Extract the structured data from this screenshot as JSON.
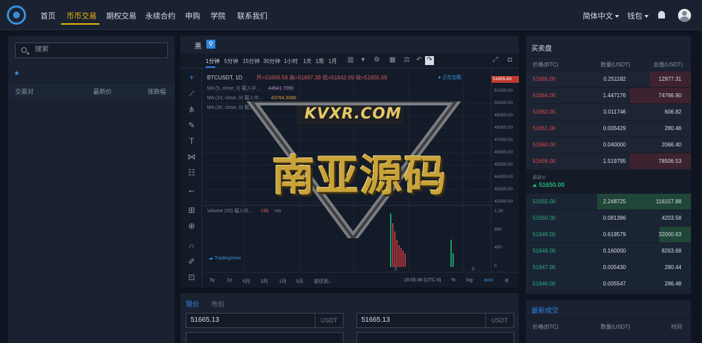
{
  "nav": {
    "items": [
      "首页",
      "币币交易",
      "期权交易",
      "永续合约",
      "申购",
      "学院",
      "联系我们"
    ],
    "active_index": 1,
    "language": "简体中文",
    "wallet": "钱包"
  },
  "market_list": {
    "search_placeholder": "搜索",
    "headers": {
      "pair": "交易对",
      "latest": "最新价",
      "change": "涨跌幅"
    }
  },
  "theme": {
    "dark_label": "黑"
  },
  "chart": {
    "timeframes": [
      "1分钟",
      "5分钟",
      "15分钟",
      "30分钟",
      "1小时",
      "1天",
      "1周",
      "1月"
    ],
    "active_timeframe": "1分钟",
    "symbol": "BTCUSDT, 1D",
    "ohlc": "开=51656.58 高=51697.38 低=51642.09 收=51655.69",
    "ma_lines": [
      {
        "label": "MA (5, close, 0) 载入中...",
        "value": "44641.7060"
      },
      {
        "label": "MA (10, close, 0) 载入中...",
        "value": "43764.3080"
      },
      {
        "label": "MA (30, close, 0) 载入中...",
        "value": ""
      }
    ],
    "status": "正在加载",
    "price_tag": "51655.69",
    "price_axis": [
      "51000.00",
      "50000.00",
      "49000.00",
      "48000.00",
      "47000.00",
      "46000.00",
      "45000.00",
      "44000.00",
      "43000.00",
      "42000.00"
    ],
    "volume_label": "Volume (20) 载入中...",
    "volume_value": "-16k",
    "volume_na": "n/a",
    "volume_axis": [
      "1.2K",
      "800",
      "400",
      "0"
    ],
    "x_labels": [
      "3",
      "3"
    ],
    "tradingview": "TradingView",
    "ranges": [
      "5y",
      "1y",
      "6月",
      "3月",
      "1月",
      "5天",
      "前往到..."
    ],
    "time_display": "19:55:46 (UTC-8)",
    "scale_options": [
      "%",
      "log",
      "auto"
    ]
  },
  "watermark": {
    "brand": "KVXR.COM",
    "main": "南亚源码"
  },
  "order_form": {
    "tabs": [
      "限价",
      "市价"
    ],
    "buy_price": "51665.13",
    "sell_price": "51665.13",
    "unit": "USDT"
  },
  "orderbook": {
    "title": "买卖盘",
    "headers": {
      "price": "价格(BTC)",
      "qty": "数量(USDT)",
      "total": "总值(USDT)"
    },
    "asks": [
      {
        "price": "51665.00",
        "qty": "0.251182",
        "total": "12977.31",
        "depth": 0.25
      },
      {
        "price": "51664.00",
        "qty": "1.447176",
        "total": "74766.90",
        "depth": 0.37
      },
      {
        "price": "51662.00",
        "qty": "0.011746",
        "total": "606.82",
        "depth": 0.0
      },
      {
        "price": "51661.00",
        "qty": "0.005429",
        "total": "280.46",
        "depth": 0.0
      },
      {
        "price": "51660.00",
        "qty": "0.040000",
        "total": "2066.40",
        "depth": 0.0
      },
      {
        "price": "51656.00",
        "qty": "1.519795",
        "total": "78506.53",
        "depth": 0.37
      }
    ],
    "last_label": "最新价",
    "last_price": "51650.00",
    "bids": [
      {
        "price": "51655.00",
        "qty": "2.248725",
        "total": "116157.88",
        "depth": 0.57
      },
      {
        "price": "51650.00",
        "qty": "0.081386",
        "total": "4203.58",
        "depth": 0.0
      },
      {
        "price": "51649.00",
        "qty": "0.619579",
        "total": "32000.63",
        "depth": 0.19
      },
      {
        "price": "51648.00",
        "qty": "0.160000",
        "total": "8263.68",
        "depth": 0.0
      },
      {
        "price": "51647.00",
        "qty": "0.005430",
        "total": "280.44",
        "depth": 0.0
      },
      {
        "price": "51646.00",
        "qty": "0.005547",
        "total": "286.48",
        "depth": 0.0
      }
    ]
  },
  "trades": {
    "title": "最新成交",
    "headers": {
      "price": "价格(BTC)",
      "qty": "数量(USDT)",
      "time": "时间"
    }
  },
  "colors": {
    "ask": "#e0494f",
    "bid": "#26b27a",
    "accent": "#f0b90b",
    "link": "#2f86e4"
  }
}
